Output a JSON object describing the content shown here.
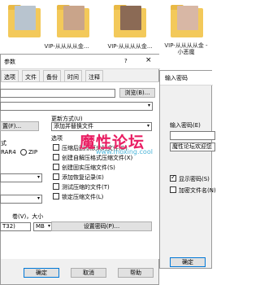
{
  "explorer": {
    "thumbnails": [
      {
        "label": ""
      },
      {
        "label": "VIP-从从从从金..."
      },
      {
        "label": "VIP-从从从从金..."
      },
      {
        "label": "VIP-从从从从金 - 小恶魔"
      }
    ]
  },
  "main_dialog": {
    "title": "参数",
    "help_glyph": "?",
    "close_glyph": "×",
    "tabs": [
      "选项",
      "文件",
      "备份",
      "时间",
      "注释"
    ],
    "browse_button": "浏览(B)...",
    "update_mode_label": "更新方式(U)",
    "update_mode_value": "添加并替换文件",
    "profile_button": "置(F)...",
    "options_label": "选项",
    "format_label": "式",
    "format_options": [
      {
        "label": "RAR4",
        "selected": false
      },
      {
        "label": "ZIP",
        "selected": false
      }
    ],
    "checkboxes": [
      {
        "label": "压缩后删除原来的文件(D)",
        "checked": false
      },
      {
        "label": "创建自解压格式压缩文件(X)",
        "checked": false
      },
      {
        "label": "创建固实压缩文件(S)",
        "checked": false
      },
      {
        "label": "添加恢复记录(E)",
        "checked": false
      },
      {
        "label": "测试压缩的文件(T)",
        "checked": false
      },
      {
        "label": "锁定压缩文件(L)",
        "checked": false
      }
    ],
    "split_label": "卷(V)，大小",
    "split_value": "T32)",
    "split_unit": "MB",
    "set_password_button": "设置密码(P)...",
    "ok_button": "确定",
    "cancel_button": "取消",
    "help_button": "帮助"
  },
  "password_dialog": {
    "title": "输入密码",
    "password_label": "输入密码(E)",
    "password_value": "",
    "confirm_value": "魔性论坛欢迎您",
    "show_password_label": "显示密码(S)",
    "show_password_checked": true,
    "encrypt_names_label": "加密文件名(N)",
    "encrypt_names_checked": false,
    "ok_button": "确定"
  },
  "watermark": {
    "text": "魔性论坛",
    "subtext": "www.moxing.cool"
  }
}
